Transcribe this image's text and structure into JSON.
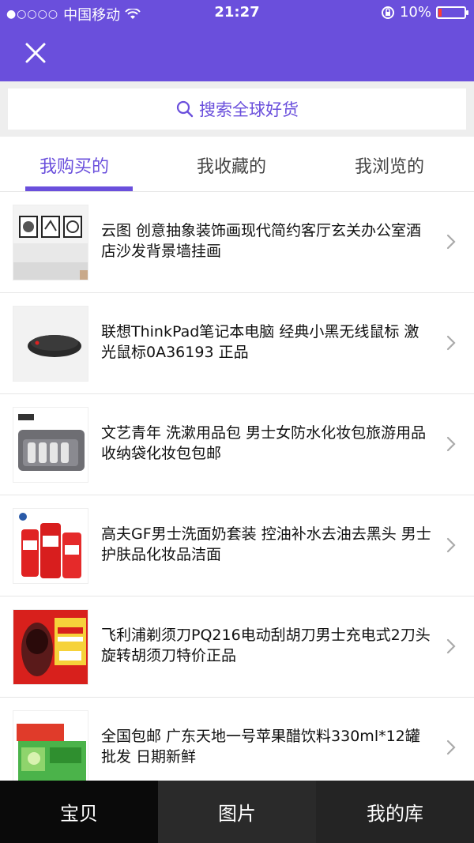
{
  "status_bar": {
    "carrier": "中国移动",
    "time": "21:27",
    "battery": "10%"
  },
  "header": {
    "close_icon": "close-icon",
    "accent_color": "#6a4fdc"
  },
  "search": {
    "placeholder": "搜索全球好货",
    "icon": "search-icon"
  },
  "tabs": [
    {
      "label": "我购买的",
      "active": true
    },
    {
      "label": "我收藏的",
      "active": false
    },
    {
      "label": "我浏览的",
      "active": false
    }
  ],
  "items": [
    {
      "title": "云图 创意抽象装饰画现代简约客厅玄关办公室酒店沙发背景墙挂画"
    },
    {
      "title": "联想ThinkPad笔记本电脑 经典小黑无线鼠标 激光鼠标0A36193 正品"
    },
    {
      "title": "文艺青年 洗漱用品包 男士女防水化妆包旅游用品收纳袋化妆包包邮"
    },
    {
      "title": "高夫GF男士洗面奶套装 控油补水去油去黑头 男士护肤品化妆品洁面"
    },
    {
      "title": "飞利浦剃须刀PQ216电动刮胡刀男士充电式2刀头旋转胡须刀特价正品"
    },
    {
      "title": "全国包邮 广东天地一号苹果醋饮料330ml*12罐批发 日期新鲜"
    }
  ],
  "bottom_nav": [
    {
      "label": "宝贝"
    },
    {
      "label": "图片"
    },
    {
      "label": "我的库"
    }
  ]
}
